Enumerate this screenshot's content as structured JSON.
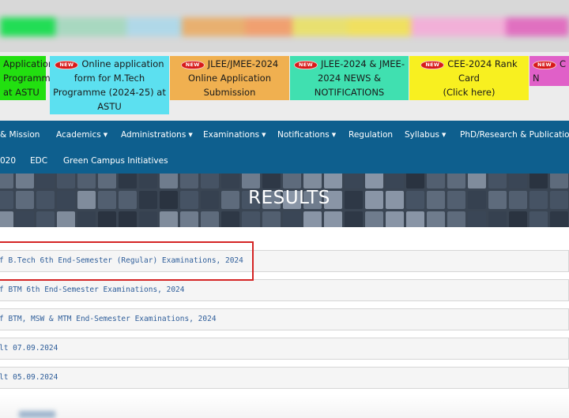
{
  "top_strip": {
    "colors": [
      "#22dd55",
      "#a8d8c0",
      "#b0d8e8",
      "#e8b070",
      "#f0a070",
      "#e8e070",
      "#f0e060",
      "#f2b0d8",
      "#e070c0"
    ]
  },
  "notices": [
    {
      "has_badge": false,
      "lines": [
        "Application",
        "Programme",
        "at ASTU"
      ],
      "bg": "#22e010"
    },
    {
      "has_badge": true,
      "lines": [
        "Online application",
        "form for M.Tech",
        "Programme (2024-25) at",
        "ASTU"
      ],
      "bg": "#5ce0f0"
    },
    {
      "has_badge": true,
      "lines": [
        "JLEE/JMEE-2024",
        "Online Application",
        "Submission"
      ],
      "bg": "#f0b050"
    },
    {
      "has_badge": true,
      "lines": [
        "JLEE-2024 & JMEE-",
        "2024 NEWS &",
        "NOTIFICATIONS"
      ],
      "bg": "#40e0b0"
    },
    {
      "has_badge": true,
      "lines": [
        "CEE-2024 Rank Card",
        "(Click here)"
      ],
      "bg": "#f8f020"
    },
    {
      "has_badge": true,
      "lines": [
        "C",
        "N"
      ],
      "bg": "#e060c8"
    }
  ],
  "new_badge_text": "NEW",
  "nav": {
    "row1": [
      {
        "label": "& Mission",
        "dropdown": false
      },
      {
        "label": "Academics",
        "dropdown": true
      },
      {
        "label": "Administrations",
        "dropdown": true
      },
      {
        "label": "Examinations",
        "dropdown": true
      },
      {
        "label": "Notifications",
        "dropdown": true
      },
      {
        "label": "Regulation",
        "dropdown": false
      },
      {
        "label": "Syllabus",
        "dropdown": true
      },
      {
        "label": "PhD/Research & Publication",
        "dropdown": true
      }
    ],
    "row2": [
      {
        "label": "020",
        "dropdown": false
      },
      {
        "label": "EDC",
        "dropdown": false
      },
      {
        "label": "Green Campus Initiatives",
        "dropdown": false
      }
    ],
    "caret": "▼"
  },
  "banner": {
    "title": "RESULTS"
  },
  "results": [
    "f B.Tech 6th End-Semester (Regular) Examinations, 2024",
    "f BTM 6th End-Semester Examinations, 2024",
    "f BTM, MSW & MTM End-Semester Examinations, 2024",
    "lt 07.09.2024",
    "lt 05.09.2024"
  ],
  "highlight_color": "#d42424"
}
